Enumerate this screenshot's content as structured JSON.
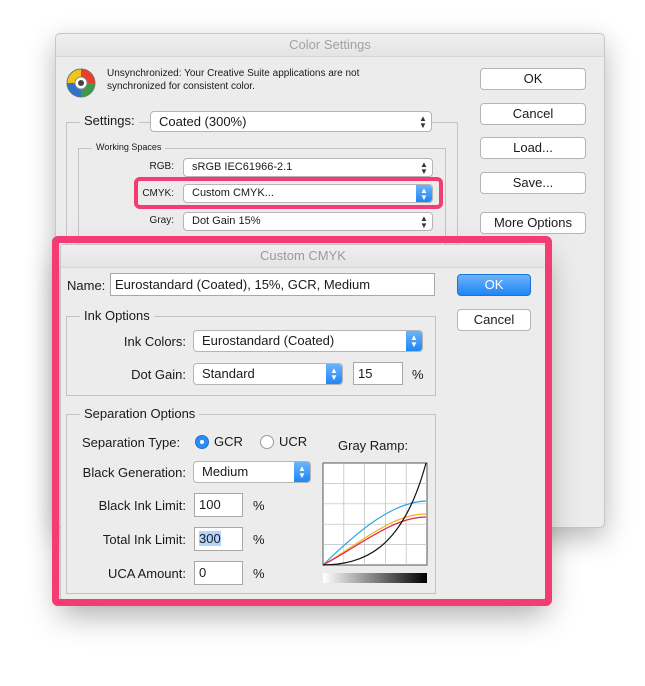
{
  "back_dialog": {
    "title": "Color Settings",
    "message": "Unsynchronized: Your Creative Suite applications are not synchronized for consistent color.",
    "settings_label": "Settings:",
    "settings_value": "Coated (300%)",
    "working_spaces_label": "Working Spaces",
    "rgb_label": "RGB:",
    "rgb_value": "sRGB IEC61966-2.1",
    "cmyk_label": "CMYK:",
    "cmyk_value": "Custom CMYK...",
    "gray_label": "Gray:",
    "gray_value": "Dot Gain 15%",
    "buttons": {
      "ok": "OK",
      "cancel": "Cancel",
      "load": "Load...",
      "save": "Save...",
      "more_options": "More Options"
    }
  },
  "front_dialog": {
    "title": "Custom CMYK",
    "name_label": "Name:",
    "name_value": "Eurostandard (Coated), 15%, GCR, Medium",
    "ok": "OK",
    "cancel": "Cancel",
    "ink_options": {
      "title": "Ink Options",
      "ink_colors_label": "Ink Colors:",
      "ink_colors_value": "Eurostandard (Coated)",
      "dot_gain_label": "Dot Gain:",
      "dot_gain_value": "Standard",
      "dot_gain_amount": "15",
      "percent": "%"
    },
    "separation_options": {
      "title": "Separation Options",
      "separation_type_label": "Separation Type:",
      "gcr_label": "GCR",
      "ucr_label": "UCR",
      "selected_type": "GCR",
      "gray_ramp_label": "Gray Ramp:",
      "black_generation_label": "Black Generation:",
      "black_generation_value": "Medium",
      "black_ink_limit_label": "Black Ink Limit:",
      "black_ink_limit_value": "100",
      "total_ink_limit_label": "Total Ink Limit:",
      "total_ink_limit_value": "300",
      "uca_amount_label": "UCA Amount:",
      "uca_amount_value": "0",
      "percent": "%"
    }
  },
  "colors": {
    "highlight": "#f43b73",
    "accent": "#1f86f5",
    "cyan_curve": "#2aa7e0",
    "magenta_curve": "#e0234a",
    "yellow_curve": "#f2b21b",
    "black_curve": "#111111"
  }
}
